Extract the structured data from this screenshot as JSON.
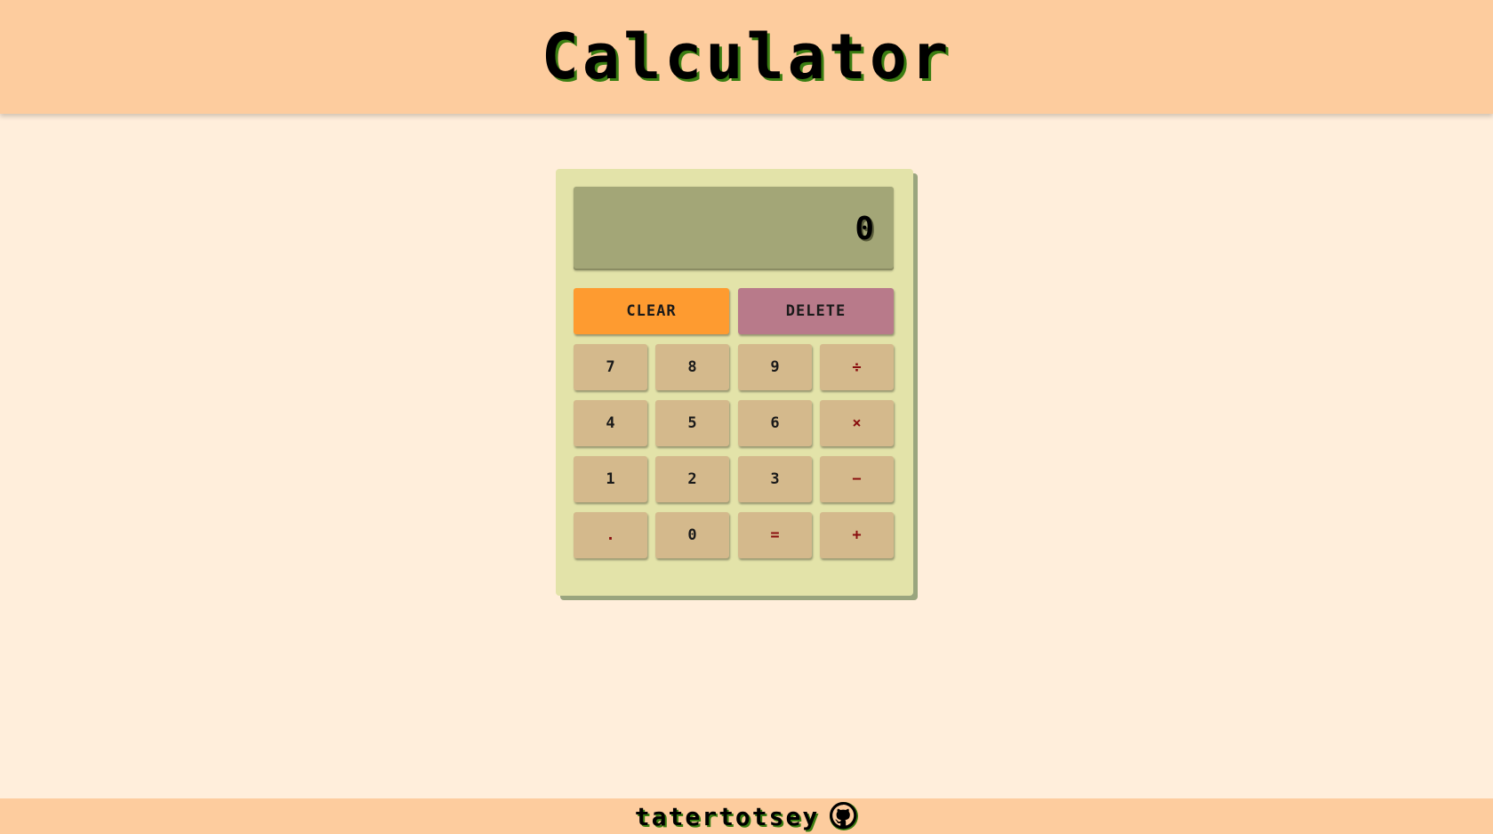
{
  "header": {
    "title": "Calculator"
  },
  "display": {
    "value": "0"
  },
  "buttons": {
    "clear": "CLEAR",
    "delete": "DELETE",
    "rows": [
      [
        "7",
        "8",
        "9",
        "÷"
      ],
      [
        "4",
        "5",
        "6",
        "×"
      ],
      [
        "1",
        "2",
        "3",
        "−"
      ],
      [
        ".",
        "0",
        "=",
        "+"
      ]
    ]
  },
  "footer": {
    "author": "tatertotsey",
    "icon": "github-icon"
  },
  "colors": {
    "header_bg": "#fdcc9e",
    "page_bg": "#ffeedb",
    "calc_body": "#e3e3a9",
    "display_bg": "#a3a677",
    "key_bg": "#d4b98c",
    "clear_bg": "#fe9b30",
    "delete_bg": "#b87a8a",
    "operator_text": "#8a0f0f"
  }
}
